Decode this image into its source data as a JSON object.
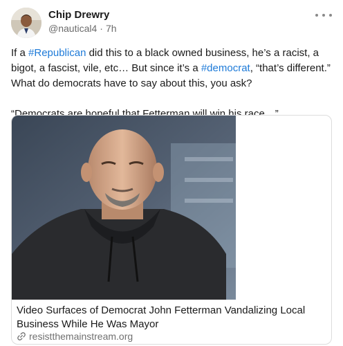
{
  "post": {
    "author": {
      "display_name": "Chip Drewry",
      "handle": "@nautical4",
      "time": "7h"
    },
    "separator": "·",
    "body": {
      "seg1": "If a ",
      "tag1": "#Republican",
      "seg2": " did this to a black owned business, he’s a racist, a bigot, a fascist, vile, etc… But since it’s a ",
      "tag2": "#democrat",
      "seg3": ", “that’s different.” What do democrats have to say about this, you ask?\n\n“Democrats are hopeful that Fetterman will win his race…”"
    },
    "link_card": {
      "title": "Video Surfaces of Democrat John Fetterman Vandalizing Local Business While He Was Mayor",
      "domain": "resistthemainstream.org"
    }
  },
  "colors": {
    "hashtag": "#1d7ad8",
    "secondary_text": "#6b6b6b",
    "card_border": "#dcdcdc"
  },
  "icons": [
    "more-options-icon",
    "link-icon"
  ]
}
